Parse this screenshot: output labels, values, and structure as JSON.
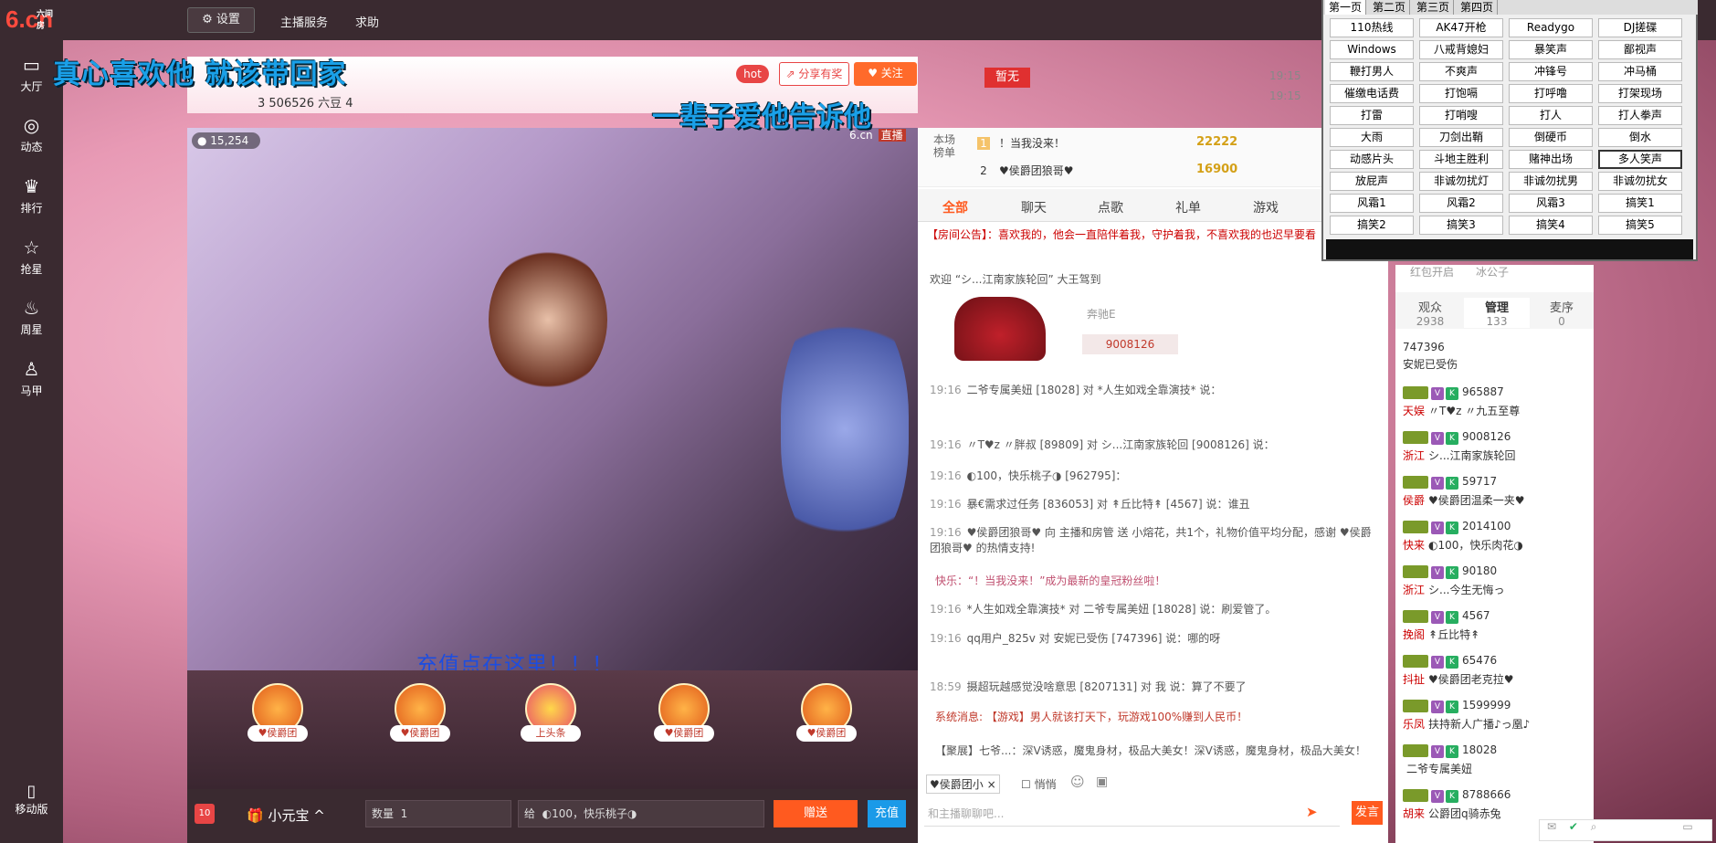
{
  "logo": {
    "main": "6.cn",
    "small": "六间房"
  },
  "leftnav": {
    "items": [
      {
        "label": "大厅",
        "icon": "tv-icon"
      },
      {
        "label": "动态",
        "icon": "compass-icon"
      },
      {
        "label": "排行",
        "icon": "crown-icon"
      },
      {
        "label": "抢星",
        "icon": "star-icon"
      },
      {
        "label": "周星",
        "icon": "pot-icon"
      },
      {
        "label": "马甲",
        "icon": "shirt-icon"
      }
    ],
    "mobile": "移动版"
  },
  "topbar": {
    "settings": "设置",
    "anchor_service": "主播服务",
    "help": "求助"
  },
  "header": {
    "banner1": "真心喜欢他 就该带回家",
    "banner2": "一辈子爱他告诉他",
    "fans": "3 506526 六豆 4",
    "hot": "hot",
    "share": "分享有奖",
    "follow": "关注",
    "flag": "暂无",
    "times": [
      "19:15",
      "19:15"
    ]
  },
  "video": {
    "viewers": "15,254",
    "brand": "6.cn",
    "live": "直播",
    "prompt": "充值点在这里！！！"
  },
  "gifts": [
    {
      "label": "♥侯爵团"
    },
    {
      "label": "♥侯爵团"
    },
    {
      "label": "上头条"
    },
    {
      "label": "♥侯爵团"
    },
    {
      "label": "♥侯爵团"
    }
  ],
  "bottombar": {
    "gift_count": "10",
    "treasure": "小元宝",
    "qty_label": "数量",
    "qty_value": "1",
    "give_to_label": "给",
    "give_to_value": "◐100，快乐桃子◑",
    "send": "赠送",
    "charge": "充值"
  },
  "rank": {
    "label": "本场榜单",
    "rows": [
      {
        "pos": "1",
        "text": "！当我没来！",
        "value": "22222"
      },
      {
        "pos": "2",
        "text": "♥侯爵团狼哥♥",
        "value": "16900"
      }
    ]
  },
  "tabs": [
    "全部",
    "聊天",
    "点歌",
    "礼单",
    "游戏"
  ],
  "announcement": "【房间公告】：喜欢我的，他会一直陪伴着我，守护着我，不喜欢我的也迟早要看",
  "welcome": "欢迎 “シ...江南家族轮回” 大王驾到",
  "car": {
    "label": "奔驰E",
    "id": "9008126"
  },
  "messages": [
    {
      "t": "19:16",
      "text": "二爷专属美妞 [18028] 对 *人生如戏全靠演技* 说："
    },
    {
      "t": "19:16",
      "text": "〃T♥z 〃胖叔 [89809] 对 シ...江南家族轮回 [9008126] 说："
    },
    {
      "t": "19:16",
      "text": "◐100，快乐桃子◑ [962795]："
    },
    {
      "t": "19:16",
      "text": "暴€需求过任务 [836053] 对 ↟丘比特↟ [4567] 说：谁丑"
    },
    {
      "t": "19:16",
      "text": "♥侯爵团狼哥♥ 向 主播和房管 送 小熔花，共1个，礼物价值平均分配，感谢 ♥侯爵团狼哥♥ 的热情支持!"
    },
    {
      "t": "",
      "text": "快乐：“！当我没来！”成为最新的皇冠粉丝啦！"
    },
    {
      "t": "19:16",
      "text": "*人生如戏全靠演技* 对 二爷专属美妞 [18028] 说：刷爱管了。"
    },
    {
      "t": "19:16",
      "text": "qq用户_825v 对 安妮已受伤 [747396] 说：哪的呀"
    },
    {
      "t": "18:59",
      "text": "摄超玩越感觉没啥意思 [8207131] 对 我 说：算了不要了"
    },
    {
      "t": "",
      "text": "系统消息: 【游戏】男人就该打天下，玩游戏100%赚到人民币！"
    },
    {
      "t": "",
      "text": "【聚展】七爷...：深V诱惑，魔鬼身材，极品大美女！深V诱惑，魔鬼身材，极品大美女！"
    }
  ],
  "chat_input": {
    "target": "♥侯爵团小",
    "whisper": "悄悄",
    "placeholder": "和主播聊聊吧...",
    "post": "发言"
  },
  "side": {
    "top_labels": [
      "红包开启",
      "冰公子"
    ],
    "tabs": [
      {
        "label": "观众",
        "count": "2938"
      },
      {
        "label": "管理",
        "count": "133"
      },
      {
        "label": "麦序",
        "count": "0"
      }
    ],
    "users": [
      {
        "id": "747396",
        "name": "安妮已受伤",
        "tag": ""
      },
      {
        "id": "965887",
        "name": "〃T♥z 〃九五至尊",
        "tag": "天娱"
      },
      {
        "id": "9008126",
        "name": "シ...江南家族轮回",
        "tag": "浙江"
      },
      {
        "id": "59717",
        "name": "♥侯爵团温柔一夹♥",
        "tag": "侯爵"
      },
      {
        "id": "2014100",
        "name": "◐100，快乐肉花◑",
        "tag": "快来"
      },
      {
        "id": "90180",
        "name": "シ...今生无悔っ",
        "tag": "浙江"
      },
      {
        "id": "4567",
        "name": "↟丘比特↟",
        "tag": "挽阁"
      },
      {
        "id": "65476",
        "name": "♥侯爵团老克拉♥",
        "tag": "抖扯"
      },
      {
        "id": "1599999",
        "name": "扶持新人广播♪っ凰♪",
        "tag": "乐凤"
      },
      {
        "id": "18028",
        "name": "二爷专属美妞",
        "tag": ""
      },
      {
        "id": "8788666",
        "name": "公爵团q骑赤兔",
        "tag": "胡来"
      }
    ]
  },
  "soundboard": {
    "tabs": [
      "第一页",
      "第二页",
      "第三页",
      "第四页"
    ],
    "cells": [
      "110热线",
      "AK47开枪",
      "Readygo",
      "DJ搓碟",
      "Windows",
      "八戒背媳妇",
      "暴笑声",
      "鄙视声",
      "鞭打男人",
      "不爽声",
      "冲锋号",
      "冲马桶",
      "催缴电话费",
      "打饱嗝",
      "打呼噜",
      "打架现场",
      "打雷",
      "打哨嗖",
      "打人",
      "打人拳声",
      "大雨",
      "刀剑出鞘",
      "倒硬币",
      "倒水",
      "动感片头",
      "斗地主胜利",
      "赌神出场",
      "多人笑声",
      "放屁声",
      "非诚勿扰灯",
      "非诚勿扰男",
      "非诚勿扰女",
      "风霜1",
      "风霜2",
      "风霜3",
      "搞笑1",
      "搞笑2",
      "搞笑3",
      "搞笑4",
      "搞笑5"
    ]
  },
  "colors": {
    "accent": "#ff5a1f",
    "brand": "#ff4b3e",
    "link": "#1a9ae8"
  }
}
